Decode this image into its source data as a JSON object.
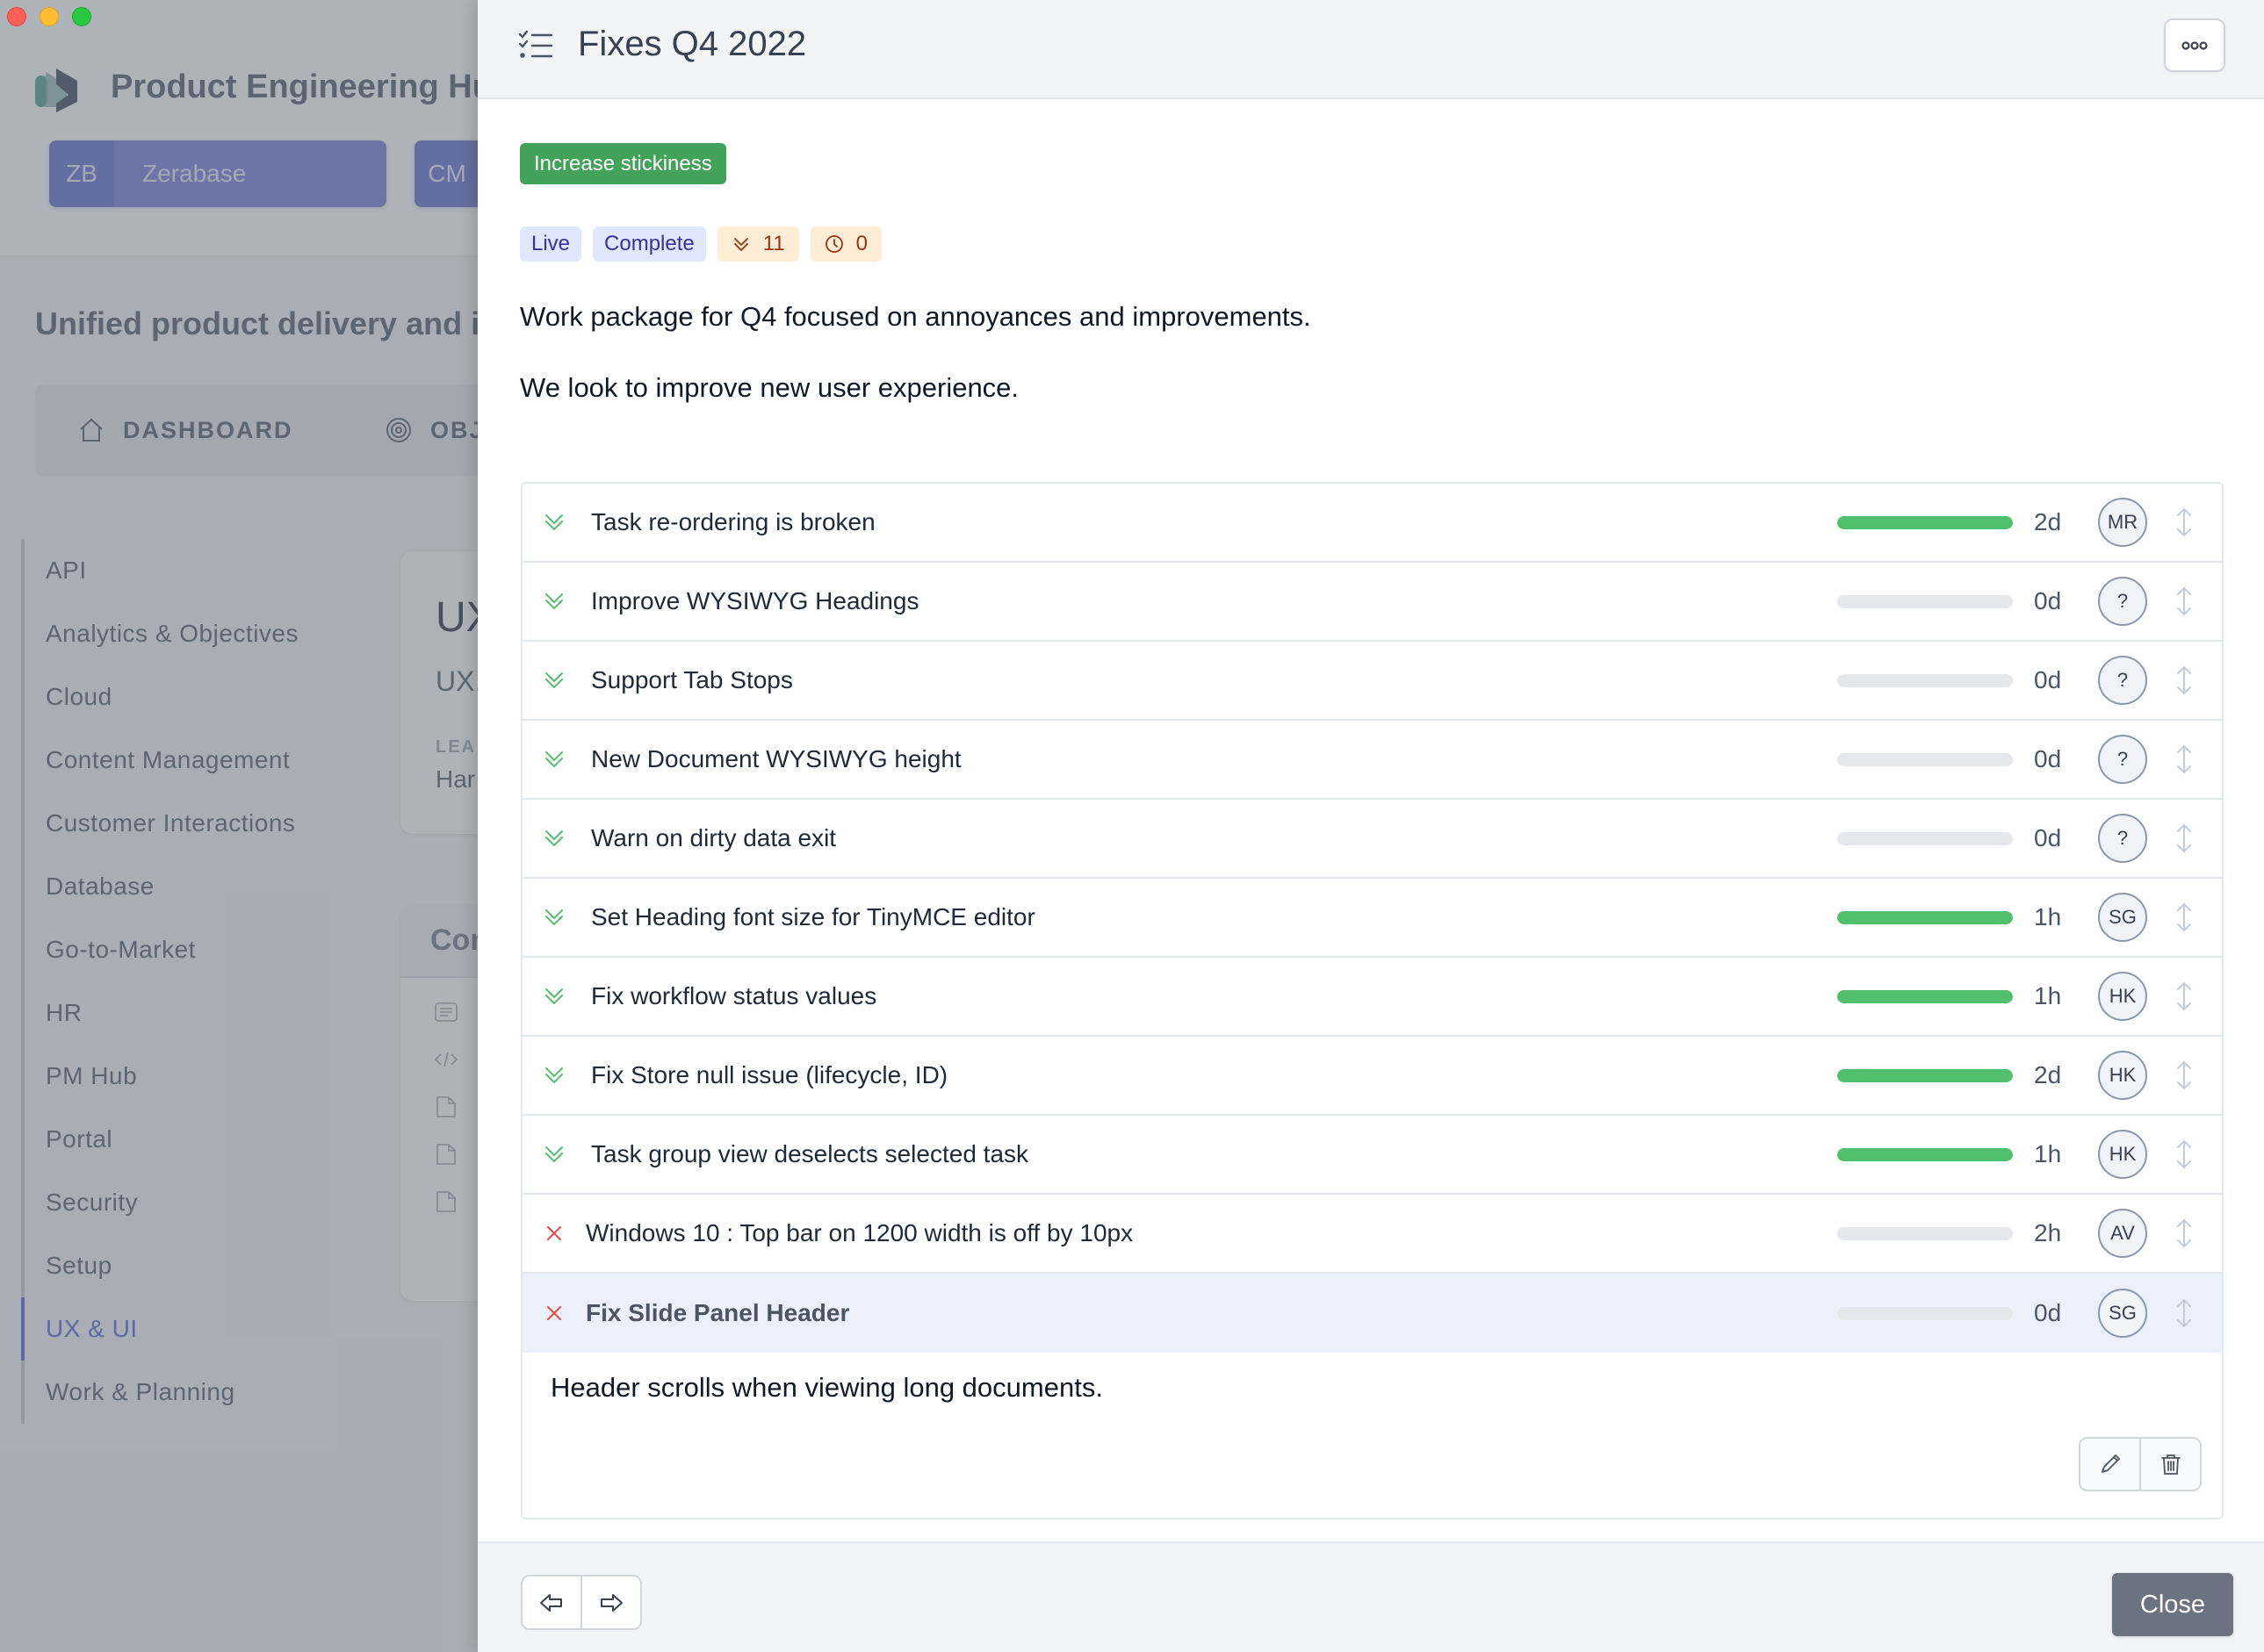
{
  "window": {
    "controls": [
      "close",
      "minimize",
      "zoom"
    ]
  },
  "background_app": {
    "title": "Product Engineering Hub",
    "workspaces": [
      {
        "abbr": "ZB",
        "name": "Zerabase"
      },
      {
        "abbr": "CM",
        "name": ""
      }
    ],
    "tagline": "Unified product delivery and in",
    "tabs": [
      {
        "label": "DASHBOARD",
        "icon": "home-icon"
      },
      {
        "label": "OBJ",
        "icon": "target-icon"
      }
    ],
    "sidebar": {
      "items": [
        {
          "label": "API",
          "active": false
        },
        {
          "label": "Analytics & Objectives",
          "active": false
        },
        {
          "label": "Cloud",
          "active": false
        },
        {
          "label": "Content Management",
          "active": false
        },
        {
          "label": "Customer Interactions",
          "active": false
        },
        {
          "label": "Database",
          "active": false
        },
        {
          "label": "Go-to-Market",
          "active": false
        },
        {
          "label": "HR",
          "active": false
        },
        {
          "label": "PM Hub",
          "active": false
        },
        {
          "label": "Portal",
          "active": false
        },
        {
          "label": "Security",
          "active": false
        },
        {
          "label": "Setup",
          "active": false
        },
        {
          "label": "UX & UI",
          "active": true
        },
        {
          "label": "Work & Planning",
          "active": false
        }
      ]
    },
    "card": {
      "title": "UX",
      "subtitle": "UX,",
      "lead_label": "LEA",
      "lead_name": "Har"
    },
    "content_card": {
      "title": "Con",
      "rows": [
        {
          "icon": "document-text-icon"
        },
        {
          "icon": "code-icon"
        },
        {
          "icon": "file-icon"
        },
        {
          "icon": "file-icon"
        },
        {
          "icon": "file-icon"
        }
      ]
    }
  },
  "panel": {
    "header": {
      "icon": "checklist-icon",
      "title": "Fixes Q4 2022",
      "menu_icon": "more-icon"
    },
    "goal_chip": "Increase stickiness",
    "badges": {
      "live": "Live",
      "status": "Complete",
      "done_count": "11",
      "pending_count": "0"
    },
    "description": [
      "Work package for Q4 focused on annoyances and improvements.",
      "We look to improve new user experience."
    ],
    "colors": {
      "done": "#52bf6c",
      "failed": "#ef4444",
      "goal": "#43a25a",
      "accent": "#4f5bd5"
    },
    "tasks": [
      {
        "name": "Task re-ordering is broken",
        "status": "done",
        "progress": 1,
        "duration": "2d",
        "assignee": "MR"
      },
      {
        "name": "Improve WYSIWYG Headings",
        "status": "done",
        "progress": 0,
        "duration": "0d",
        "assignee": "?"
      },
      {
        "name": "Support Tab Stops",
        "status": "done",
        "progress": 0,
        "duration": "0d",
        "assignee": "?"
      },
      {
        "name": "New Document WYSIWYG height",
        "status": "done",
        "progress": 0,
        "duration": "0d",
        "assignee": "?"
      },
      {
        "name": "Warn on dirty data exit",
        "status": "done",
        "progress": 0,
        "duration": "0d",
        "assignee": "?"
      },
      {
        "name": "Set Heading font size for TinyMCE editor",
        "status": "done",
        "progress": 1,
        "duration": "1h",
        "assignee": "SG"
      },
      {
        "name": "Fix workflow status values",
        "status": "done",
        "progress": 1,
        "duration": "1h",
        "assignee": "HK"
      },
      {
        "name": "Fix Store null issue (lifecycle, ID)",
        "status": "done",
        "progress": 1,
        "duration": "2d",
        "assignee": "HK"
      },
      {
        "name": "Task group view deselects selected task",
        "status": "done",
        "progress": 1,
        "duration": "1h",
        "assignee": "HK"
      },
      {
        "name": "Windows 10 : Top bar on 1200 width is off by 10px",
        "status": "failed",
        "progress": 0,
        "duration": "2h",
        "assignee": "AV"
      },
      {
        "name": "Fix Slide Panel Header",
        "status": "failed",
        "progress": 0,
        "duration": "0d",
        "assignee": "SG",
        "selected": true
      }
    ],
    "selected_task_detail": "Header scrolls when viewing long documents.",
    "footer": {
      "prev_icon": "arrow-left-icon",
      "next_icon": "arrow-right-icon",
      "close_label": "Close"
    }
  }
}
